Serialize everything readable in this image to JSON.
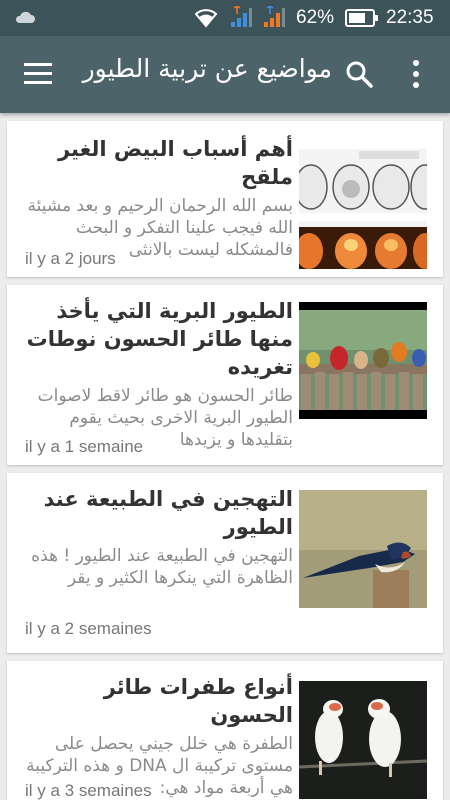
{
  "status_bar": {
    "battery_percent": "62%",
    "time": "22:35"
  },
  "app_bar": {
    "title": "مواضيع عن تربية الطيور",
    "icons": [
      "menu-icon",
      "search-icon",
      "more-vert-icon"
    ]
  },
  "articles": [
    {
      "title": "أهم أسباب البيض الغير ملقح",
      "excerpt": "بسم الله الرحمان الرحيم و بعد مشيئة الله فيجب علينا التفكر و البحث فالمشكله ليست بالانثى",
      "time": "il y a 2 jours",
      "thumb": "egg-candling-image"
    },
    {
      "title": "الطيور البرية التي يأخذ منها طائر الحسون نوطات تغريده",
      "excerpt": "طائر الحسون هو طائر لاقط لاصوات الطيور البرية الاخرى بحيث يقوم بتقليدها و يزيدها",
      "time": "il y a 1 semaine",
      "thumb": "wild-birds-fence-image"
    },
    {
      "title": "التهجين في الطبيعة عند الطيور",
      "excerpt": "التهجين في الطبيعة عند الطيور ! هذه الظاهرة التي ينكرها الكثير و يقر",
      "time": "il y a 2 semaines",
      "thumb": "swallow-image"
    },
    {
      "title": "أنواع طفرات طائر الحسون",
      "excerpt": "الطفرة هي خلل جيني يحصل على مستوى تركيبة ال DNA و هذه التركيبة هي أربعة مواد هي:",
      "time": "il y a 3 semaines",
      "thumb": "white-goldfinch-image"
    }
  ],
  "colors": {
    "status_bar": "#3c5359",
    "app_bar": "#4c636a",
    "background": "#ececec"
  }
}
